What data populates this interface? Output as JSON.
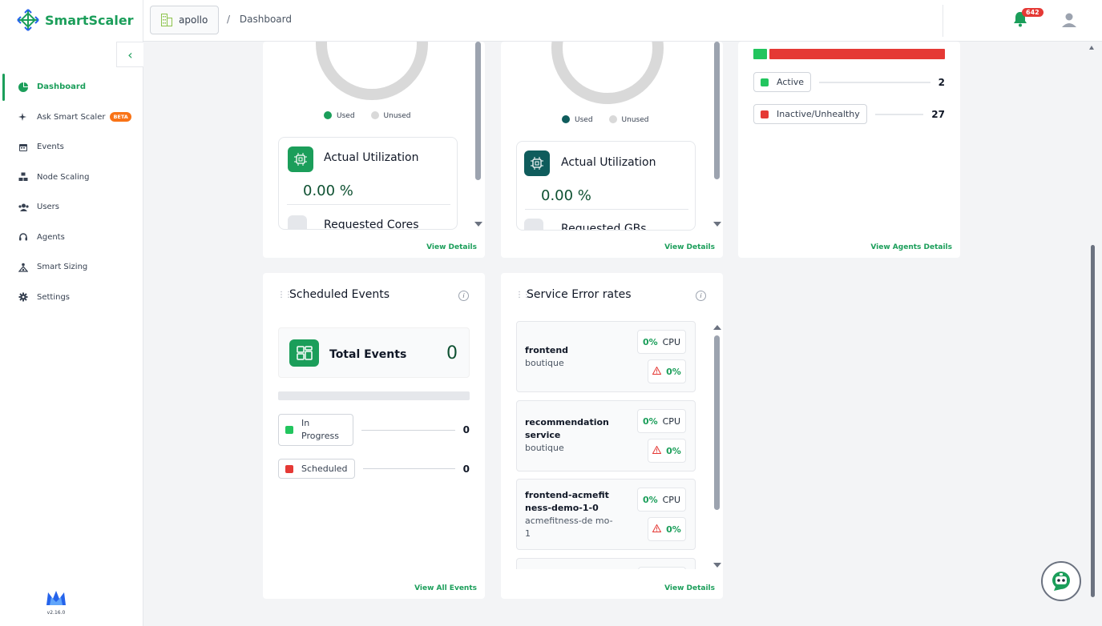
{
  "app": {
    "name": "SmartScaler",
    "version": "v2.16.0"
  },
  "topbar": {
    "workspace": "apollo",
    "breadcrumb_sep": "/",
    "breadcrumb": "Dashboard",
    "notification_count": "642"
  },
  "sidebar": {
    "items": [
      {
        "label": "Dashboard",
        "icon": "pie-chart-icon",
        "active": true
      },
      {
        "label": "Ask Smart Scaler",
        "icon": "sparkle-icon",
        "badge": "BETA"
      },
      {
        "label": "Events",
        "icon": "calendar-icon"
      },
      {
        "label": "Node Scaling",
        "icon": "nodes-icon"
      },
      {
        "label": "Users",
        "icon": "users-icon"
      },
      {
        "label": "Agents",
        "icon": "headset-icon"
      },
      {
        "label": "Smart Sizing",
        "icon": "smart-sizing-icon"
      },
      {
        "label": "Settings",
        "icon": "gear-icon"
      }
    ]
  },
  "cpu_card": {
    "legend_used": "Used",
    "legend_unused": "Unused",
    "util_title": "Actual Utilization",
    "util_value": "0.00 %",
    "next_title": "Requested Cores",
    "footer": "View Details",
    "used_fraction": 0
  },
  "memory_card": {
    "legend_used": "Used",
    "legend_unused": "Unused",
    "util_title": "Actual Utilization",
    "util_value": "0.00 %",
    "next_title": "Requested GBs",
    "footer": "View Details",
    "used_fraction": 0
  },
  "agents_card": {
    "statuses": [
      {
        "label": "Active",
        "count": "2",
        "color": "#22c55e"
      },
      {
        "label": "Inactive/Unhealthy",
        "count": "27",
        "color": "#e53935"
      }
    ],
    "footer": "View Agents Details"
  },
  "events_card": {
    "title": "Scheduled Events",
    "total_label": "Total Events",
    "total_value": "0",
    "statuses": [
      {
        "label_line1": "In",
        "label_line2": "Progress",
        "count": "0",
        "color": "#22c55e"
      },
      {
        "label": "Scheduled",
        "count": "0",
        "color": "#e53935"
      }
    ],
    "footer": "View All Events"
  },
  "errors_card": {
    "title": "Service Error rates",
    "services": [
      {
        "name": "frontend",
        "namespace": "boutique",
        "cpu_pct": "0%",
        "cpu_label": "CPU",
        "err_pct": "0%"
      },
      {
        "name": "recommendation service",
        "namespace": "boutique",
        "cpu_pct": "0%",
        "cpu_label": "CPU",
        "err_pct": "0%"
      },
      {
        "name": "frontend-acmefit ness-demo-1-0",
        "namespace": "acmefitness-de mo-1",
        "cpu_pct": "0%",
        "cpu_label": "CPU",
        "err_pct": "0%"
      }
    ],
    "footer": "View Details"
  },
  "colors": {
    "brand": "#1b9e5a",
    "error": "#e53935",
    "active": "#22c55e",
    "unused": "#d9d9d9"
  }
}
